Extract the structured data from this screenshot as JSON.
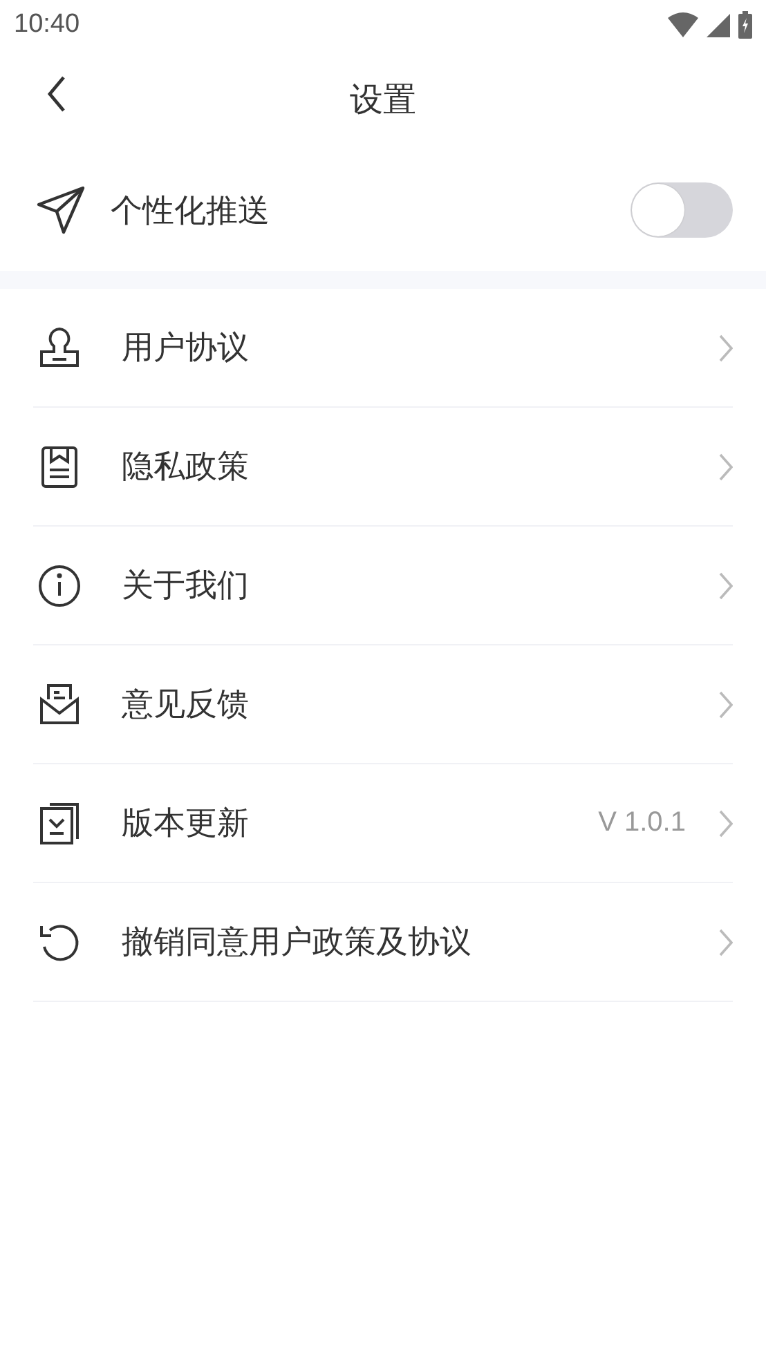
{
  "status_bar": {
    "time": "10:40"
  },
  "header": {
    "title": "设置"
  },
  "push": {
    "label": "个性化推送",
    "on": false
  },
  "items": [
    {
      "kind": "stamp",
      "label": "用户协议"
    },
    {
      "kind": "document",
      "label": "隐私政策"
    },
    {
      "kind": "info",
      "label": "关于我们"
    },
    {
      "kind": "mail",
      "label": "意见反馈"
    },
    {
      "kind": "download",
      "label": "版本更新",
      "value": "V 1.0.1"
    },
    {
      "kind": "undo",
      "label": "撤销同意用户政策及协议"
    }
  ]
}
